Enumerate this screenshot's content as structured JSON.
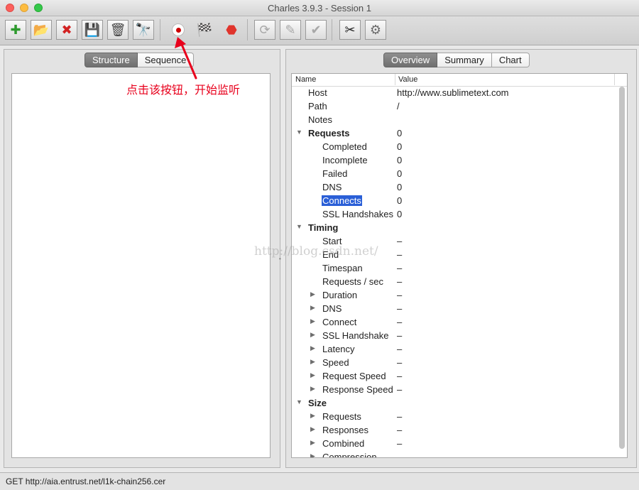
{
  "window": {
    "title": "Charles 3.9.3 - Session 1"
  },
  "toolbar": {
    "buttons": [
      {
        "name": "new-session-button",
        "icon": "new-session-icon",
        "glyph": "✚",
        "color": "#2e9a2e"
      },
      {
        "name": "open-session-button",
        "icon": "open-folder-icon",
        "glyph": "📂",
        "color": "#2f6fcc"
      },
      {
        "name": "close-session-button",
        "icon": "close-session-icon",
        "glyph": "✖",
        "color": "#d22222"
      },
      {
        "name": "save-session-button",
        "icon": "save-disk-icon",
        "glyph": "💾",
        "color": "#333333"
      },
      {
        "name": "clear-session-button",
        "icon": "trash-icon",
        "glyph": "🗑",
        "color": "#444444"
      },
      {
        "name": "find-button",
        "icon": "binoculars-icon",
        "glyph": "🔭",
        "color": "#222222"
      },
      {
        "name": "record-button",
        "icon": "record-icon",
        "glyph": "⏺",
        "color": "#cc0000"
      },
      {
        "name": "throttling-button",
        "icon": "checkered-flag-icon",
        "glyph": "🏁",
        "color": "#222222"
      },
      {
        "name": "breakpoints-button",
        "icon": "stop-sign-icon",
        "glyph": "⬣",
        "color": "#e0342c"
      },
      {
        "name": "repeat-button",
        "icon": "repeat-icon",
        "glyph": "⟳",
        "color": "#a8a8a8"
      },
      {
        "name": "edit-button",
        "icon": "pencil-icon",
        "glyph": "✎",
        "color": "#a8a8a8"
      },
      {
        "name": "validate-button",
        "icon": "checkmark-icon",
        "glyph": "✔",
        "color": "#a8a8a8"
      },
      {
        "name": "tools-button",
        "icon": "tools-icon",
        "glyph": "✂",
        "color": "#222222"
      },
      {
        "name": "settings-button",
        "icon": "gear-icon",
        "glyph": "⚙",
        "color": "#6a6a6a"
      }
    ]
  },
  "left_panel": {
    "tabs": [
      {
        "label": "Structure",
        "active": true
      },
      {
        "label": "Sequence",
        "active": false
      }
    ]
  },
  "right_panel": {
    "tabs": [
      {
        "label": "Overview",
        "active": true
      },
      {
        "label": "Summary",
        "active": false
      },
      {
        "label": "Chart",
        "active": false
      }
    ],
    "columns": {
      "name": "Name",
      "value": "Value"
    },
    "rows": [
      {
        "name": "Host",
        "value": "http://www.sublimetext.com",
        "level": 1,
        "toggle": ""
      },
      {
        "name": "Path",
        "value": "/",
        "level": 1,
        "toggle": ""
      },
      {
        "name": "Notes",
        "value": "",
        "level": 1,
        "toggle": ""
      },
      {
        "name": "Requests",
        "value": "0",
        "level": 1,
        "toggle": "▼",
        "section": true
      },
      {
        "name": "Completed",
        "value": "0",
        "level": 2,
        "toggle": ""
      },
      {
        "name": "Incomplete",
        "value": "0",
        "level": 2,
        "toggle": ""
      },
      {
        "name": "Failed",
        "value": "0",
        "level": 2,
        "toggle": ""
      },
      {
        "name": "DNS",
        "value": "0",
        "level": 2,
        "toggle": ""
      },
      {
        "name": "Connects",
        "value": "0",
        "level": 2,
        "toggle": "",
        "selected": true
      },
      {
        "name": "SSL Handshakes",
        "value": "0",
        "level": 2,
        "toggle": ""
      },
      {
        "name": "Timing",
        "value": "",
        "level": 1,
        "toggle": "▼",
        "section": true
      },
      {
        "name": "Start",
        "value": "–",
        "level": 2,
        "toggle": ""
      },
      {
        "name": "End",
        "value": "–",
        "level": 2,
        "toggle": ""
      },
      {
        "name": "Timespan",
        "value": "–",
        "level": 2,
        "toggle": ""
      },
      {
        "name": "Requests / sec",
        "value": "–",
        "level": 2,
        "toggle": ""
      },
      {
        "name": "Duration",
        "value": "–",
        "level": 2,
        "toggle": "▶"
      },
      {
        "name": "DNS",
        "value": "–",
        "level": 2,
        "toggle": "▶"
      },
      {
        "name": "Connect",
        "value": "–",
        "level": 2,
        "toggle": "▶"
      },
      {
        "name": "SSL Handshake",
        "value": "–",
        "level": 2,
        "toggle": "▶"
      },
      {
        "name": "Latency",
        "value": "–",
        "level": 2,
        "toggle": "▶"
      },
      {
        "name": "Speed",
        "value": "–",
        "level": 2,
        "toggle": "▶"
      },
      {
        "name": "Request Speed",
        "value": "–",
        "level": 2,
        "toggle": "▶"
      },
      {
        "name": "Response Speed",
        "value": "–",
        "level": 2,
        "toggle": "▶"
      },
      {
        "name": "Size",
        "value": "",
        "level": 1,
        "toggle": "▼",
        "section": true
      },
      {
        "name": "Requests",
        "value": "–",
        "level": 2,
        "toggle": "▶"
      },
      {
        "name": "Responses",
        "value": "–",
        "level": 2,
        "toggle": "▶"
      },
      {
        "name": "Combined",
        "value": "–",
        "level": 2,
        "toggle": "▶"
      },
      {
        "name": "Compression",
        "value": "–",
        "level": 2,
        "toggle": "▶"
      }
    ]
  },
  "annotation": {
    "text": "点击该按钮，开始监听",
    "color": "#e8001c"
  },
  "watermark": {
    "text": "http://blog.csdn.net/"
  },
  "statusbar": {
    "text": "GET http://aia.entrust.net/l1k-chain256.cer"
  },
  "colors": {
    "selection": "#2a5fd7",
    "active_tab": "#7a7a7a"
  }
}
